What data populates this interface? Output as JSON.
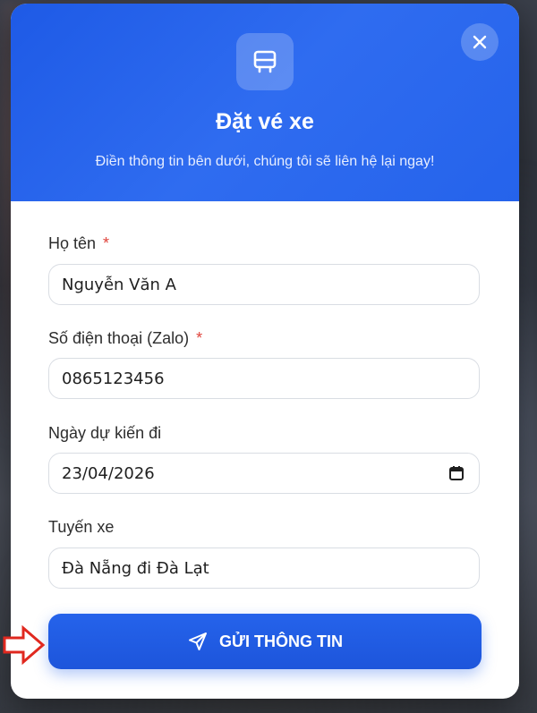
{
  "modal": {
    "title": "Đặt vé xe",
    "subtitle": "Điền thông tin bên dưới, chúng tôi sẽ liên hệ lại ngay!",
    "badge_icon": "bus-icon",
    "close_icon": "close-icon"
  },
  "form": {
    "name": {
      "label": "Họ tên",
      "required_mark": "*",
      "value": "Nguyễn Văn A"
    },
    "phone": {
      "label": "Số điện thoại (Zalo)",
      "required_mark": "*",
      "value": "0865123456"
    },
    "date": {
      "label": "Ngày dự kiến đi",
      "value": "23/04/2026",
      "icon": "calendar-icon"
    },
    "route": {
      "label": "Tuyến xe",
      "value": "Đà Nẵng đi Đà Lạt"
    }
  },
  "submit": {
    "label": "GỬI THÔNG TIN",
    "icon": "send-icon"
  },
  "annotation": {
    "icon": "arrow-right-icon",
    "color": "#e0281f"
  },
  "colors": {
    "accent": "#2563eb",
    "required": "#e0443c"
  }
}
